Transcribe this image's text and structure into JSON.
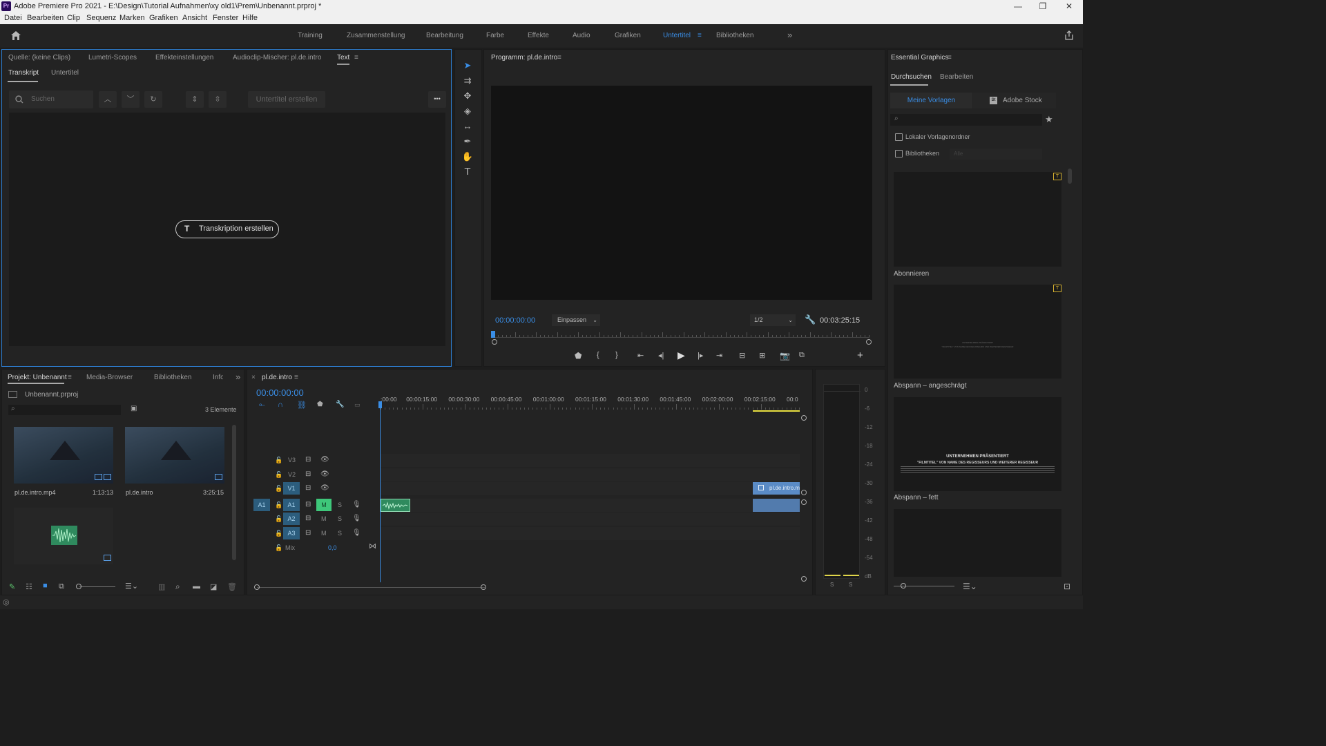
{
  "app": {
    "logo_text": "Pr",
    "title": "Adobe Premiere Pro 2021 - E:\\Design\\Tutorial Aufnahmen\\xy old1\\Prem\\Unbenannt.prproj *"
  },
  "window_controls": {
    "minimize": "—",
    "restore": "❐",
    "close": "✕"
  },
  "menu": [
    "Datei",
    "Bearbeiten",
    "Clip",
    "Sequenz",
    "Marken",
    "Grafiken",
    "Ansicht",
    "Fenster",
    "Hilfe"
  ],
  "workspaces": {
    "items": [
      "Training",
      "Zusammenstellung",
      "Bearbeitung",
      "Farbe",
      "Effekte",
      "Audio",
      "Grafiken",
      "Untertitel",
      "Bibliotheken"
    ],
    "active": "Untertitel",
    "more": "»"
  },
  "source_panel": {
    "tabs": [
      "Quelle: (keine Clips)",
      "Lumetri-Scopes",
      "Effekteinstellungen",
      "Audioclip-Mischer: pl.de.intro",
      "Text"
    ],
    "active_tab": "Text",
    "subtabs": [
      "Transkript",
      "Untertitel"
    ],
    "active_subtab": "Transkript",
    "search_placeholder": "Suchen",
    "create_subtitles": "Untertitel erstellen",
    "create_transcription": "Transkription erstellen",
    "more_menu": "•••"
  },
  "program_monitor": {
    "title": "Programm: pl.de.intro",
    "timecode": "00:00:00:00",
    "fit": "Einpassen",
    "resolution": "1/2",
    "duration": "00:03:25:15"
  },
  "essential_graphics": {
    "title": "Essential Graphics",
    "tabs": [
      "Durchsuchen",
      "Bearbeiten"
    ],
    "active_tab": "Durchsuchen",
    "sources": [
      "Meine Vorlagen",
      "Adobe Stock"
    ],
    "active_source": "Meine Vorlagen",
    "stock_badge": "St",
    "local_folder": "Lokaler Vorlagenordner",
    "libraries": "Bibliotheken",
    "libraries_select": "Alle",
    "templates": [
      {
        "name": "Abonnieren"
      },
      {
        "name": "Abspann – angeschrägt",
        "thumb_line1": "UNTERNEHMEN PRÄSENTIERT",
        "thumb_line2": "\"FILMTITEL\" VON NAME DES REGISSEURS UND WEITERER REGISSEUR"
      },
      {
        "name": "Abspann – fett",
        "thumb_line1": "UNTERNEHMEN PRÄSENTIERT",
        "thumb_line2": "\"FILMTITEL\" VON NAME DES REGISSEURS UND WEITERER REGISSEUR"
      },
      {
        "name": ""
      }
    ]
  },
  "project_panel": {
    "tabs": [
      "Projekt: Unbenannt",
      "Media-Browser",
      "Bibliotheken",
      "Info"
    ],
    "tab_info_visible": "Info",
    "active_tab": "Projekt: Unbenannt",
    "project_file": "Unbenannt.prproj",
    "item_count": "3 Elemente",
    "items": [
      {
        "name": "pl.de.intro.mp4",
        "duration": "1:13:13"
      },
      {
        "name": "pl.de.intro",
        "duration": "3:25:15"
      },
      {
        "name": "",
        "duration": ""
      }
    ],
    "more": "»"
  },
  "timeline": {
    "sequence_name": "pl.de.intro",
    "timecode": "00:00:00:00",
    "ruler": [
      ":00:00",
      "00:00:15:00",
      "00:00:30:00",
      "00:00:45:00",
      "00:01:00:00",
      "00:01:15:00",
      "00:01:30:00",
      "00:01:45:00",
      "00:02:00:00",
      "00:02:15:00",
      "00:0"
    ],
    "video_tracks": [
      "V3",
      "V2",
      "V1"
    ],
    "audio_tracks": [
      "A1",
      "A2",
      "A3"
    ],
    "source_patch_audio": "A1",
    "mix_label": "Mix",
    "mix_value": "0,0",
    "clip_v1": "pl.de.intro.m",
    "track_mute": "M",
    "track_solo": "S"
  },
  "audio_meter": {
    "scale": [
      "0",
      "-6",
      "-12",
      "-18",
      "-24",
      "-30",
      "-36",
      "-42",
      "-48",
      "-54",
      "dB"
    ],
    "solo_left": "S",
    "solo_right": "S"
  },
  "colors": {
    "accent": "#3a8ee6",
    "panel_bg": "#232323",
    "audio_clip": "#2f8a5e",
    "video_clip": "#5a8bc6",
    "mute_active": "#3ec77a"
  }
}
